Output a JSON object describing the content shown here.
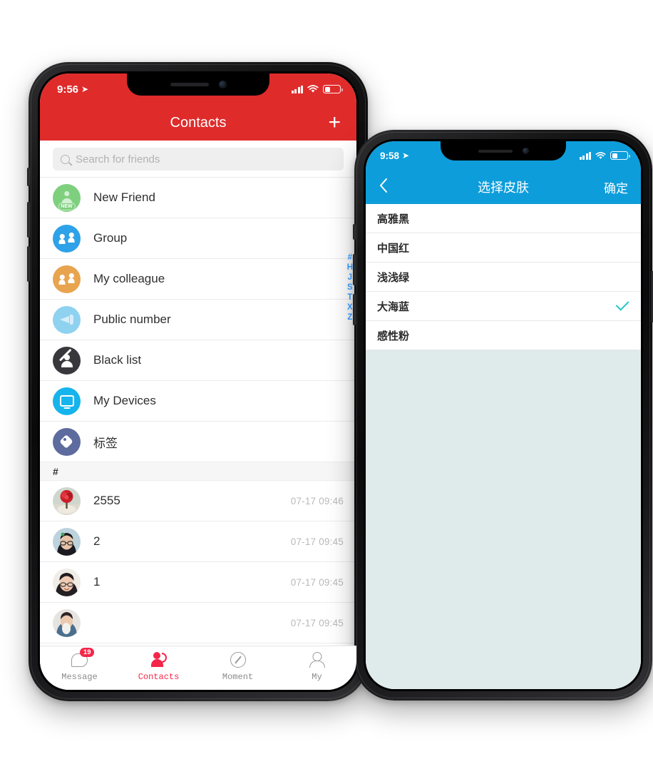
{
  "phone1": {
    "status": {
      "time": "9:56",
      "location_icon": "location-arrow-icon",
      "signal_icon": "signal-bars-icon",
      "wifi_icon": "wifi-icon",
      "battery_icon": "battery-low-icon"
    },
    "nav": {
      "title": "Contacts",
      "add_icon": "plus-icon",
      "accent_color": "#e02b2b"
    },
    "search": {
      "placeholder": "Search for friends",
      "icon": "search-icon"
    },
    "entries": [
      {
        "label": "New Friend",
        "icon": "new-friend-icon",
        "badge": "NEW"
      },
      {
        "label": "Group",
        "icon": "group-icon"
      },
      {
        "label": "My colleague",
        "icon": "colleague-icon"
      },
      {
        "label": "Public number",
        "icon": "megaphone-icon"
      },
      {
        "label": "Black list",
        "icon": "blocked-user-icon"
      },
      {
        "label": "My Devices",
        "icon": "monitor-icon"
      },
      {
        "label": "标签",
        "icon": "tag-icon"
      }
    ],
    "section_header": "#",
    "contacts": [
      {
        "name": "2555",
        "time": "07-17 09:46",
        "avatar": "rose-photo-avatar"
      },
      {
        "name": "2",
        "time": "07-17 09:45",
        "avatar": "woman-glasses-avatar"
      },
      {
        "name": "1",
        "time": "07-17 09:45",
        "avatar": "woman-smiling-avatar"
      },
      {
        "name": "",
        "time": "07-17 09:45",
        "avatar": "person-photo-avatar"
      }
    ],
    "index_letters": [
      "#",
      "H",
      "J",
      "S",
      "T",
      "X",
      "Z"
    ],
    "index_color": "#2d8ef0",
    "tabs": [
      {
        "label": "Message",
        "icon": "chat-bubble-icon",
        "badge": "19",
        "active": false
      },
      {
        "label": "Contacts",
        "icon": "contacts-person-icon",
        "active": true
      },
      {
        "label": "Moment",
        "icon": "compass-icon",
        "active": false
      },
      {
        "label": "My",
        "icon": "user-outline-icon",
        "active": false
      }
    ],
    "active_tab_color": "#f4264a"
  },
  "phone2": {
    "status": {
      "time": "9:58",
      "location_icon": "location-arrow-icon",
      "signal_icon": "signal-bars-icon",
      "wifi_icon": "wifi-icon",
      "battery_icon": "battery-low-icon"
    },
    "nav": {
      "back_icon": "chevron-left-icon",
      "title": "选择皮肤",
      "confirm": "确定",
      "accent_color": "#0d9ddb"
    },
    "skins": [
      {
        "name": "高雅黑",
        "selected": false
      },
      {
        "name": "中国红",
        "selected": false
      },
      {
        "name": "浅浅绿",
        "selected": false
      },
      {
        "name": "大海蓝",
        "selected": true
      },
      {
        "name": "感性粉",
        "selected": false
      }
    ],
    "check_color": "#28c7c9",
    "background_color": "#dfebea"
  }
}
